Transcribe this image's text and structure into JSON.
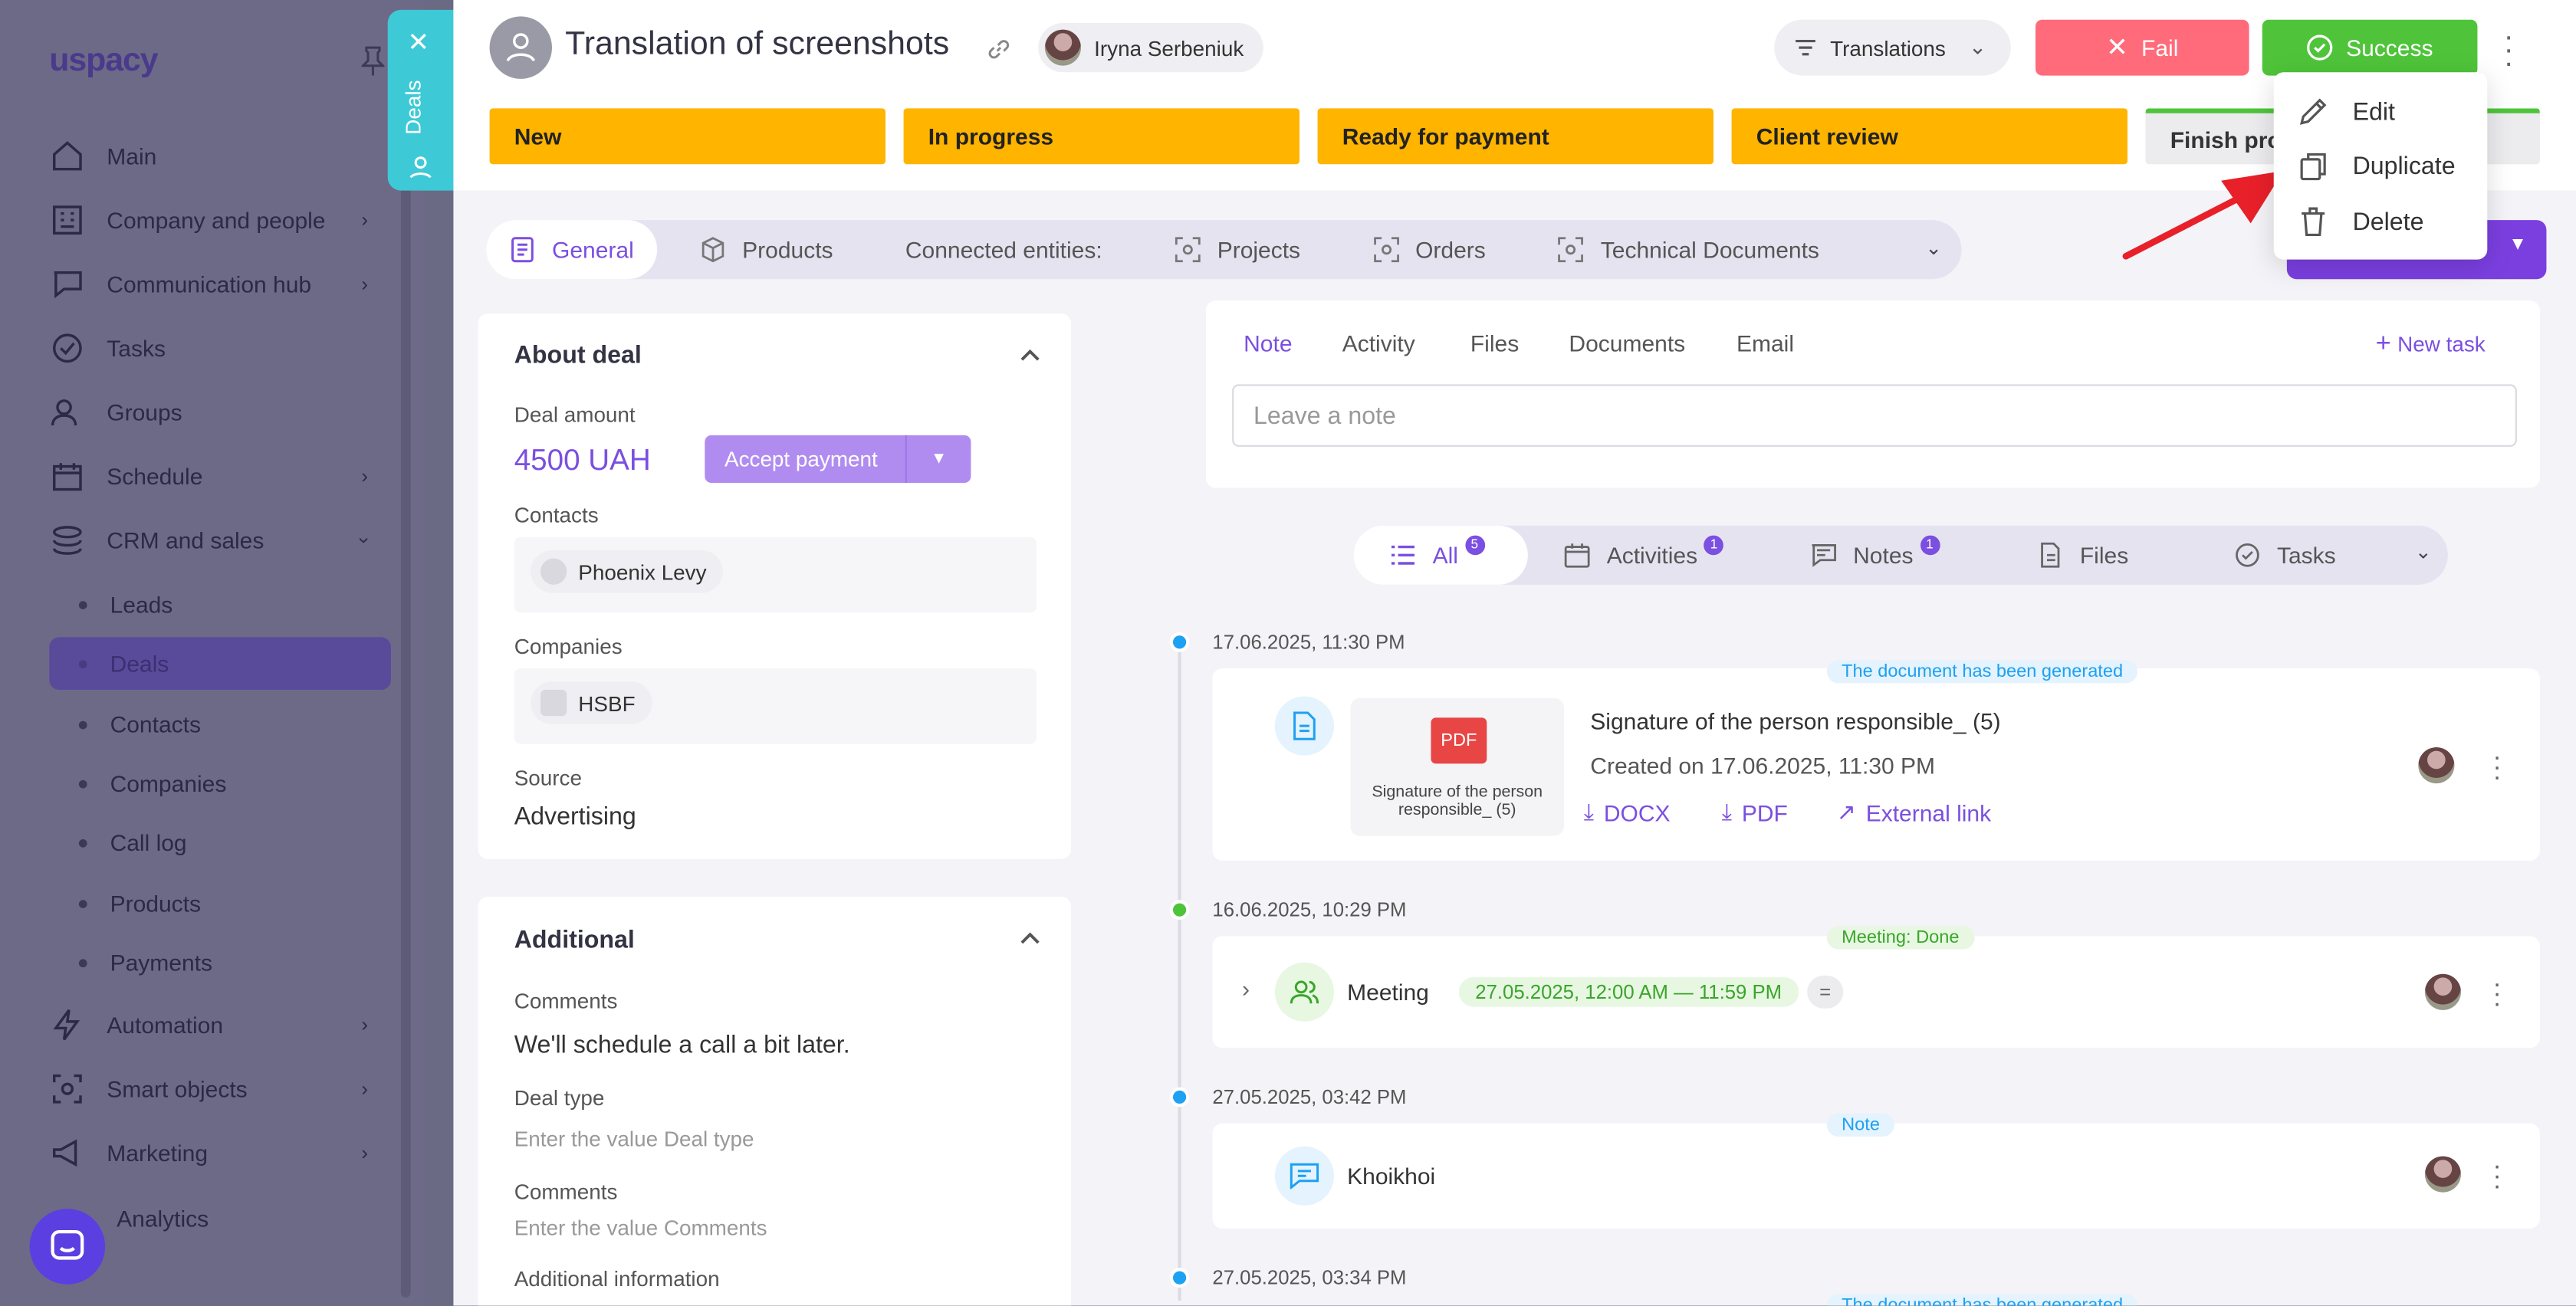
{
  "sidebar": {
    "logo": "uspacy",
    "items": [
      {
        "label": "Main",
        "icon": "home-icon"
      },
      {
        "label": "Company and people",
        "icon": "building-icon"
      },
      {
        "label": "Communication hub",
        "icon": "chat-edit-icon"
      },
      {
        "label": "Tasks",
        "icon": "check-circle-icon"
      },
      {
        "label": "Groups",
        "icon": "users-icon"
      },
      {
        "label": "Schedule",
        "icon": "calendar-icon"
      },
      {
        "label": "CRM and sales",
        "icon": "stack-icon"
      }
    ],
    "sub_items": [
      "Leads",
      "Deals",
      "Contacts",
      "Companies",
      "Call log",
      "Products",
      "Payments"
    ],
    "items_bottom": [
      {
        "label": "Automation",
        "icon": "bolt-icon"
      },
      {
        "label": "Smart objects",
        "icon": "scan-icon"
      },
      {
        "label": "Marketing",
        "icon": "megaphone-icon"
      },
      {
        "label": "Analytics",
        "icon": "chart-icon"
      }
    ]
  },
  "deals_tab": {
    "label": "Deals"
  },
  "header": {
    "title": "Translation of screenshots",
    "user": "Iryna Serbeniuk",
    "pipeline": "Translations",
    "fail_label": "Fail",
    "success_label": "Success"
  },
  "stages": [
    "New",
    "In progress",
    "Ready for payment",
    "Client review",
    "Finish pro"
  ],
  "tabs": [
    {
      "label": "General",
      "icon": "document-icon"
    },
    {
      "label": "Products",
      "icon": "box-icon"
    },
    {
      "label": "Connected entities:",
      "icon": ""
    },
    {
      "label": "Projects",
      "icon": "scan-icon"
    },
    {
      "label": "Orders",
      "icon": "scan-icon"
    },
    {
      "label": "Technical Documents",
      "icon": "scan-icon"
    }
  ],
  "about": {
    "title": "About deal",
    "amount_label": "Deal amount",
    "amount": "4500 UAH",
    "accept_label": "Accept payment",
    "contacts_label": "Contacts",
    "contact": "Phoenix Levy",
    "companies_label": "Companies",
    "company": "HSBF",
    "source_label": "Source",
    "source": "Advertising"
  },
  "additional": {
    "title": "Additional",
    "comments_label": "Comments",
    "comments": "We'll schedule a call a bit later.",
    "deal_type_label": "Deal type",
    "deal_type_placeholder": "Enter the value Deal type",
    "comments2_label": "Comments",
    "comments2_placeholder": "Enter the value Comments",
    "additional_info_label": "Additional information"
  },
  "note_card": {
    "tabs": [
      "Note",
      "Activity",
      "Files",
      "Documents",
      "Email"
    ],
    "new_task": "New task",
    "placeholder": "Leave a note"
  },
  "filters": [
    {
      "label": "All",
      "badge": "5"
    },
    {
      "label": "Activities",
      "badge": "1"
    },
    {
      "label": "Notes",
      "badge": "1"
    },
    {
      "label": "Files",
      "badge": ""
    },
    {
      "label": "Tasks",
      "badge": ""
    }
  ],
  "timeline": [
    {
      "date": "17.06.2025, 11:30 PM",
      "tag": "The document has been generated",
      "file_badge": "PDF",
      "file_caption": "Signature of the person responsible_ (5)",
      "title": "Signature of the person responsible_ (5)",
      "created": "Created on 17.06.2025, 11:30 PM",
      "links": [
        "DOCX",
        "PDF",
        "External link"
      ]
    },
    {
      "date": "16.06.2025, 10:29 PM",
      "tag": "Meeting: Done",
      "title": "Meeting",
      "time_range": "27.05.2025, 12:00 AM — 11:59 PM"
    },
    {
      "date": "27.05.2025, 03:42 PM",
      "tag": "Note",
      "title": "Khoikhoi"
    },
    {
      "date": "27.05.2025, 03:34 PM",
      "tag": "The document has been generated"
    }
  ],
  "menu": {
    "items": [
      "Edit",
      "Duplicate",
      "Delete"
    ]
  },
  "colors": {
    "accent": "#7b4fe0",
    "stage": "#ffb400",
    "fail": "#ff6b7a",
    "success": "#4fc43a",
    "arrow": "#e8202a"
  }
}
